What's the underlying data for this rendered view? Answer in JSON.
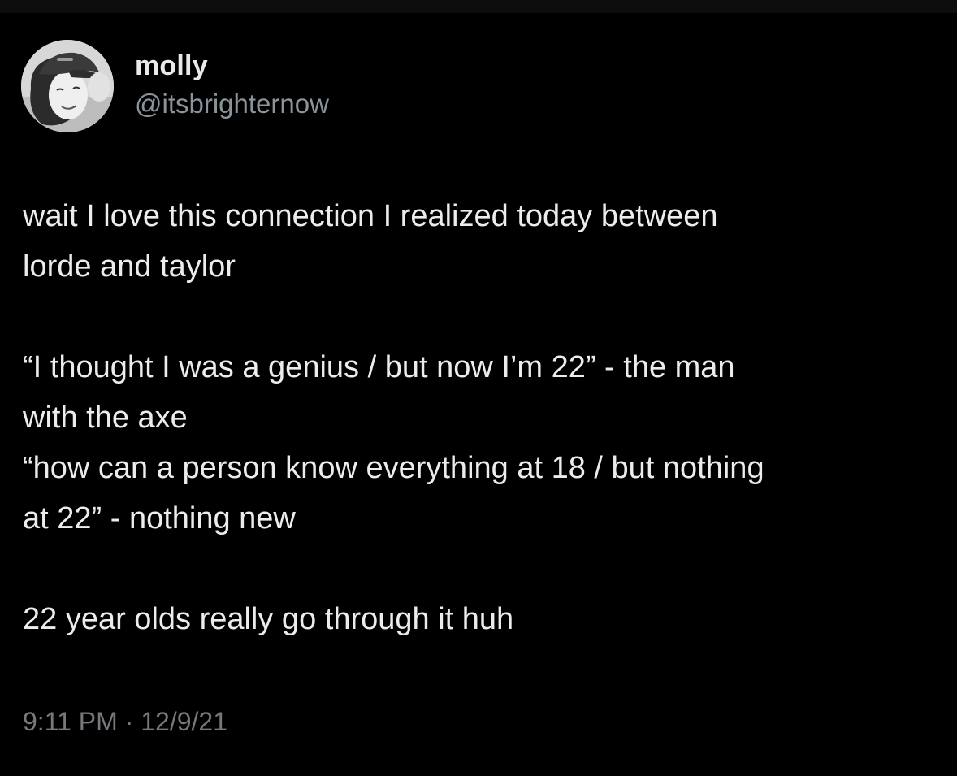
{
  "author": {
    "display_name": "molly",
    "handle": "@itsbrighternow"
  },
  "tweet": {
    "paragraphs": [
      [
        "wait I love this connection I realized today between",
        "lorde and taylor"
      ],
      [
        "“I thought I was a genius / but now I’m 22” - the man",
        "with the axe",
        "“how can a person know everything at 18 / but nothing",
        "at 22” - nothing new"
      ],
      [
        "22 year olds really go through it huh"
      ]
    ],
    "timestamp": "9:11 PM · 12/9/21"
  },
  "colors": {
    "background": "#000000",
    "text": "#ececec",
    "secondary": "#8b949a"
  }
}
